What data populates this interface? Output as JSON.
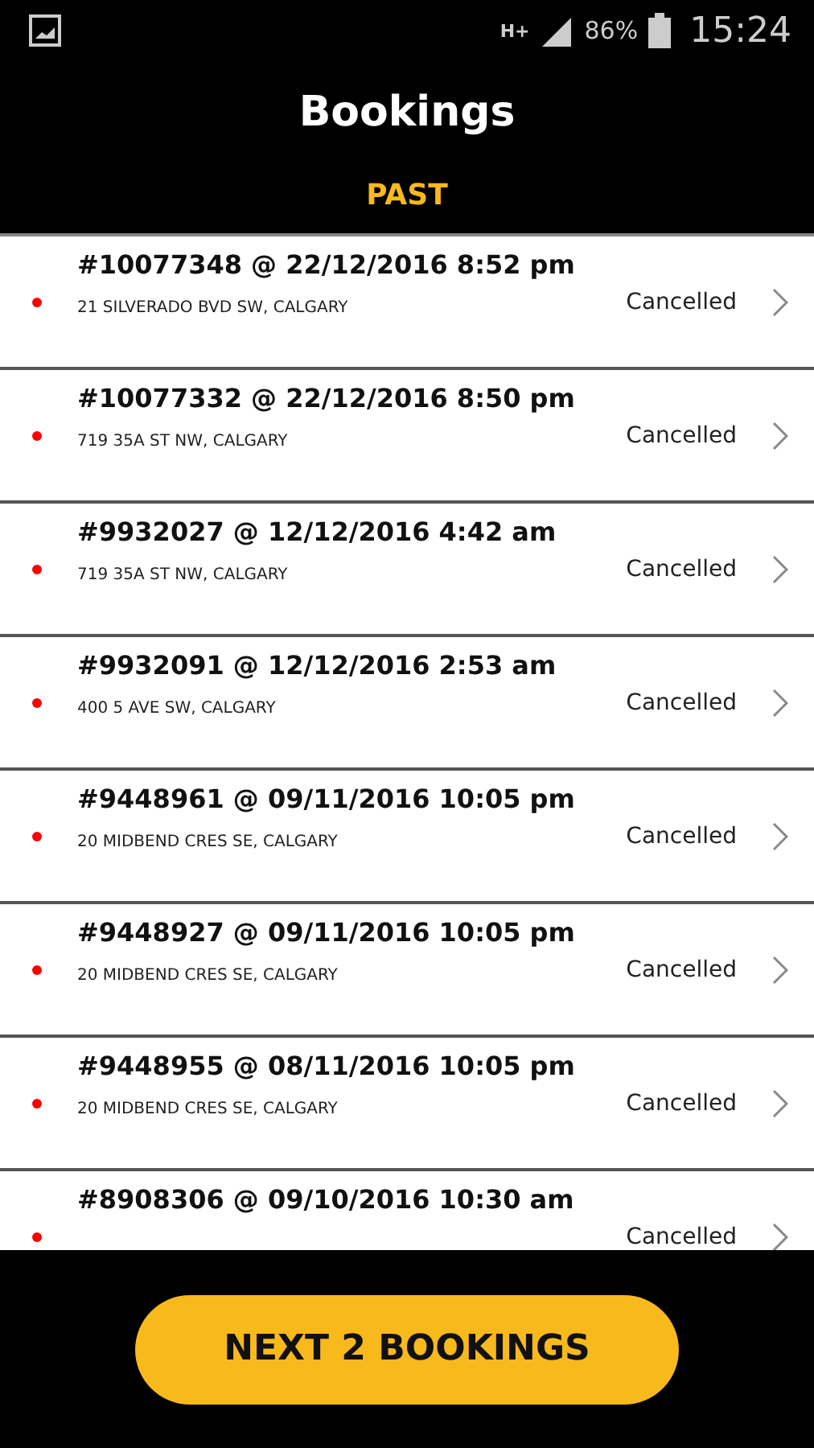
{
  "status_bar": {
    "network": "H+",
    "battery": "86%",
    "time": "15:24"
  },
  "title": "Bookings",
  "section": "PAST",
  "bookings": [
    {
      "title": "#10077348 @ 22/12/2016 8:52 pm",
      "address": "21 SILVERADO BVD SW, CALGARY",
      "status": "Cancelled"
    },
    {
      "title": "#10077332 @ 22/12/2016 8:50 pm",
      "address": "719 35A ST NW, CALGARY",
      "status": "Cancelled"
    },
    {
      "title": "#9932027 @ 12/12/2016 4:42 am",
      "address": "719 35A ST NW, CALGARY",
      "status": "Cancelled"
    },
    {
      "title": "#9932091 @ 12/12/2016 2:53 am",
      "address": "400 5 AVE SW, CALGARY",
      "status": "Cancelled"
    },
    {
      "title": "#9448961 @ 09/11/2016 10:05 pm",
      "address": "20 MIDBEND CRES SE, CALGARY",
      "status": "Cancelled"
    },
    {
      "title": "#9448927 @ 09/11/2016 10:05 pm",
      "address": "20 MIDBEND CRES SE, CALGARY",
      "status": "Cancelled"
    },
    {
      "title": "#9448955 @ 08/11/2016 10:05 pm",
      "address": "20 MIDBEND CRES SE, CALGARY",
      "status": "Cancelled"
    },
    {
      "title": "#8908306 @ 09/10/2016 10:30 am",
      "status": "Cancelled"
    }
  ],
  "next_button": "NEXT 2 BOOKINGS"
}
